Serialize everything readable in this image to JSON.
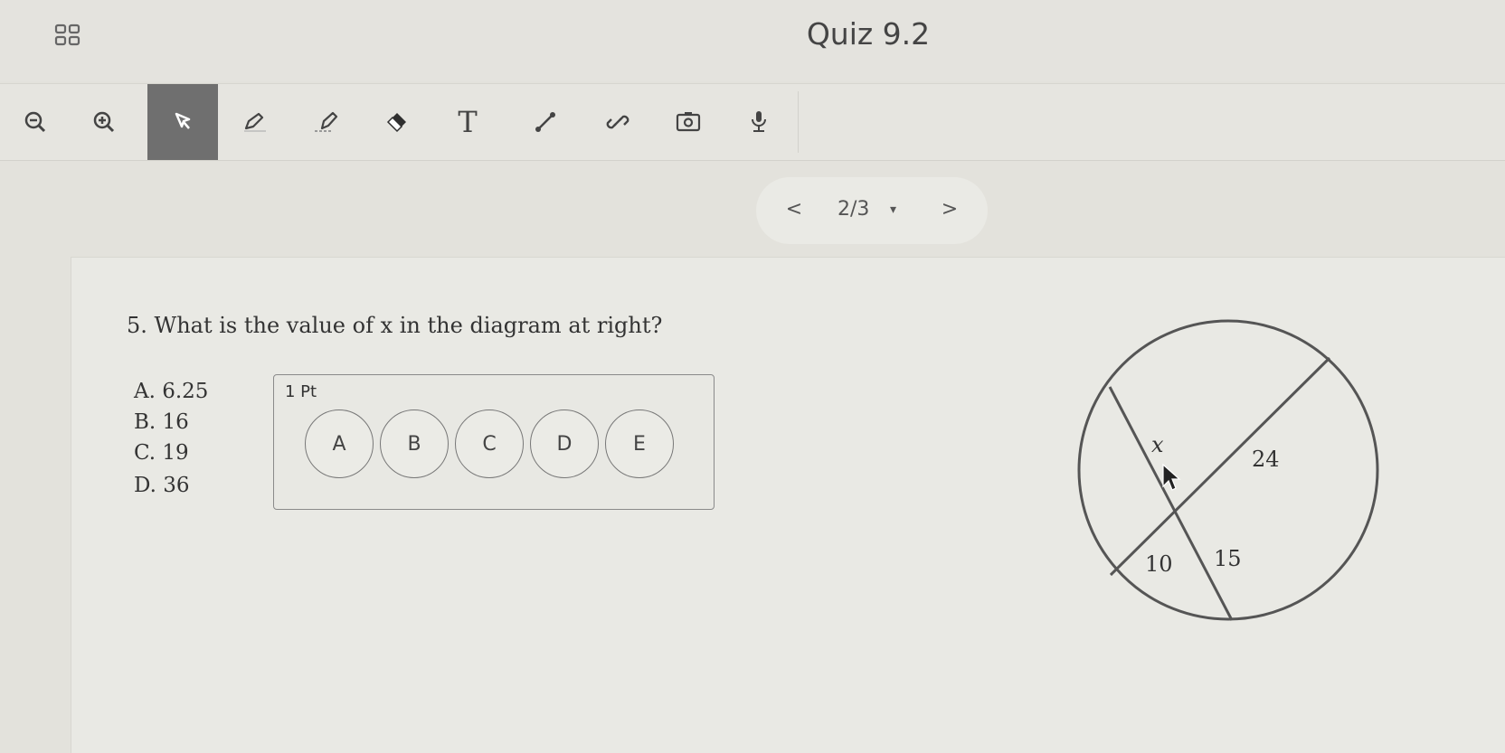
{
  "header": {
    "title": "Quiz 9.2",
    "apps_icon": "grid-icon"
  },
  "toolbar": {
    "tools": [
      {
        "name": "zoom-out",
        "icon": "zoom-out-icon",
        "active": false
      },
      {
        "name": "zoom-in",
        "icon": "zoom-in-icon",
        "active": false
      },
      {
        "name": "select",
        "icon": "pointer-icon",
        "active": true
      },
      {
        "name": "pen",
        "icon": "pen-icon",
        "active": false
      },
      {
        "name": "highlighter",
        "icon": "highlighter-icon",
        "active": false
      },
      {
        "name": "eraser",
        "icon": "eraser-icon",
        "active": false
      },
      {
        "name": "text",
        "icon": "text-icon",
        "active": false
      },
      {
        "name": "line",
        "icon": "line-icon",
        "active": false
      },
      {
        "name": "link",
        "icon": "link-icon",
        "active": false
      },
      {
        "name": "camera",
        "icon": "camera-icon",
        "active": false
      },
      {
        "name": "microphone",
        "icon": "microphone-icon",
        "active": false
      }
    ],
    "text_glyph": "T",
    "active_color": "#6f6f6f"
  },
  "pager": {
    "prev": "<",
    "page": "2/3",
    "caret": "▾",
    "next": ">"
  },
  "question": {
    "text": "5. What is the value of x in the diagram at right?",
    "choices": [
      "A. 6.25",
      "B. 16",
      "C. 19",
      "D. 36"
    ]
  },
  "answer_box": {
    "points": "1 Pt",
    "bubbles": [
      "A",
      "B",
      "C",
      "D",
      "E"
    ]
  },
  "diagram": {
    "labels": {
      "x": "x",
      "seg_24": "24",
      "seg_10": "10",
      "seg_15": "15"
    }
  }
}
